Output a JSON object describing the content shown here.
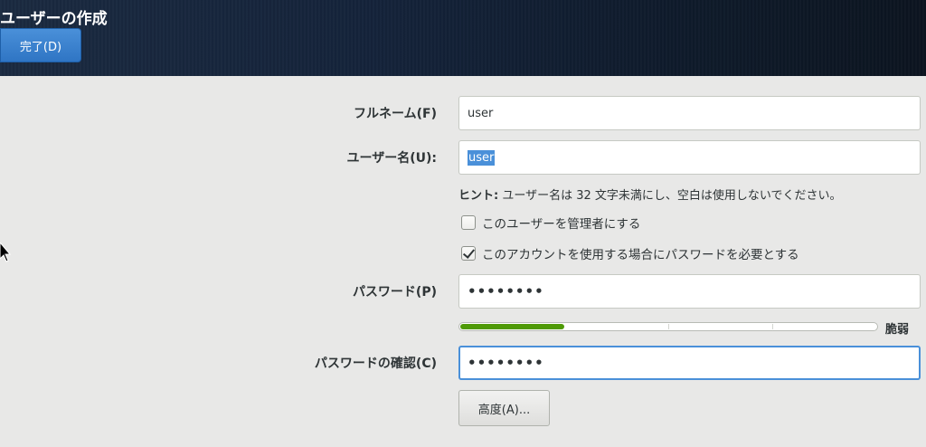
{
  "header": {
    "title": "ユーザーの作成",
    "done_label": "完了(D)"
  },
  "form": {
    "fullname_label": "フルネーム(F)",
    "fullname_value": "user",
    "username_label": "ユーザー名(U):",
    "username_value": "user",
    "hint_prefix": "ヒント:",
    "hint_text": "ユーザー名は 32 文字未満にし、空白は使用しないでください。",
    "admin_label": "このユーザーを管理者にする",
    "admin_checked": false,
    "require_password_label": "このアカウントを使用する場合にパスワードを必要とする",
    "require_password_checked": true,
    "password_label": "パスワード(P)",
    "password_value": "••••••••",
    "strength_level": 0.25,
    "strength_label": "脆弱",
    "confirm_label": "パスワードの確認(C)",
    "confirm_value": "••••••••",
    "advanced_label": "高度(A)..."
  },
  "colors": {
    "accent": "#4a90d9",
    "strength_weak": "#4e9a06",
    "header_bg": "#14233a"
  }
}
